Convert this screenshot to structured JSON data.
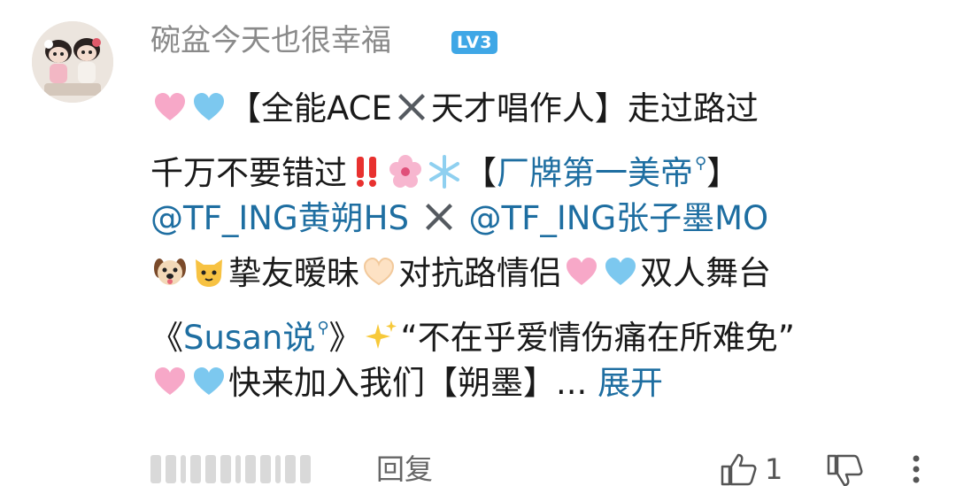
{
  "comment": {
    "username": "碗盆今天也很幸福",
    "level": "LV3",
    "avatar_icon": "avatar-dolls-photo",
    "lines": [
      {
        "p1": "【全能ACE",
        "p2": "天才唱作人】走过路过"
      },
      {
        "p1": "千万不要错过",
        "p2": "【",
        "link": "厂牌第一美帝",
        "p3": "】"
      },
      {
        "link1": "@TF_ING黄朔HS",
        "link2": "@TF_ING张子墨MO"
      },
      {
        "p1": "挚友暧昧",
        "p2": "对抗路情侣",
        "p3": "双人舞台"
      },
      {
        "p1": "《",
        "link": "Susan说",
        "p2": "》",
        "p3": "“不在乎爱情伤痛在所难免”"
      },
      {
        "p1": "快来加入我们【朔墨】...",
        "expand": "展开"
      }
    ],
    "emojis": [
      "pink-heart-icon",
      "light-blue-heart-icon",
      "cross-mark-icon",
      "double-exclamation-icon",
      "cherry-blossom-icon",
      "snowflake-icon",
      "search-icon",
      "dog-face-icon",
      "cat-face-icon",
      "heart-hands-icon",
      "sparkles-icon"
    ]
  },
  "footer": {
    "reply_label": "回复",
    "like_count": "1"
  },
  "colors": {
    "link": "#1e6ea1",
    "username": "#8a8a8a",
    "badge": "#3fa7e6",
    "text": "#1a1a1a"
  }
}
